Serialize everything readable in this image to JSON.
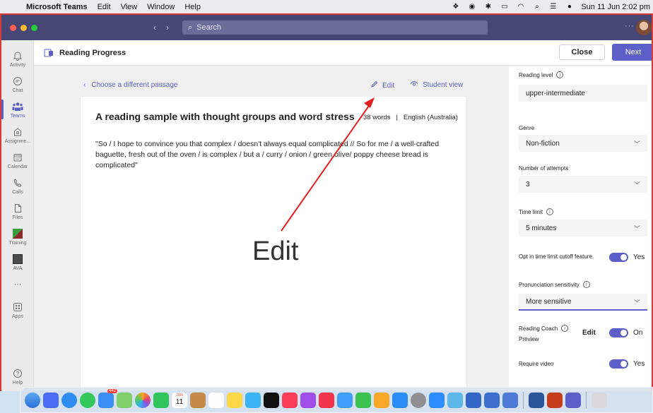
{
  "menubar": {
    "app_name": "Microsoft Teams",
    "menus": [
      "Edit",
      "View",
      "Window",
      "Help"
    ],
    "datetime": "Sun 11 Jun  2:02 pm"
  },
  "titlebar": {
    "search_placeholder": "Search",
    "more_label": "···"
  },
  "rail": {
    "items": [
      {
        "label": "Activity",
        "icon": "bell-icon"
      },
      {
        "label": "Chat",
        "icon": "chat-icon"
      },
      {
        "label": "Teams",
        "icon": "teams-icon"
      },
      {
        "label": "Assignme...",
        "icon": "assignments-icon"
      },
      {
        "label": "Calendar",
        "icon": "calendar-icon"
      },
      {
        "label": "Calls",
        "icon": "phone-icon"
      },
      {
        "label": "Files",
        "icon": "file-icon"
      },
      {
        "label": "Training",
        "icon": "training-icon"
      },
      {
        "label": "AVA",
        "icon": "ava-icon"
      },
      {
        "label": "···",
        "icon": "more-icon"
      },
      {
        "label": "Apps",
        "icon": "apps-icon"
      },
      {
        "label": "Help",
        "icon": "help-icon"
      }
    ]
  },
  "header": {
    "title": "Reading Progress",
    "close_label": "Close",
    "next_label": "Next"
  },
  "content": {
    "back_label": "Choose a different passage",
    "edit_label": "Edit",
    "student_view_label": "Student view",
    "passage_title": "A reading sample with thought groups and word stress",
    "word_count": "38 words",
    "separator": "|",
    "language": "English (Australia)",
    "passage_text": "\"So / I hope to convince you that complex / doesn't always equal complicated // So for me / a well-crafted baguette, fresh out of the oven / is complex / but a / curry / onion / green olive/ poppy cheese bread is complicated\""
  },
  "annotation": {
    "text": "Edit"
  },
  "settings": {
    "reading_level_label": "Reading level",
    "reading_level_value": "upper-intermediate",
    "genre_label": "Genre",
    "genre_value": "Non-fiction",
    "attempts_label": "Number of attempts",
    "attempts_value": "3",
    "time_limit_label": "Time limit",
    "time_limit_value": "5 minutes",
    "cutoff_label": "Opt in time limit cutoff feature.",
    "cutoff_value": "Yes",
    "pronunciation_label": "Pronunciation sensitivity",
    "pronunciation_value": "More sensitive",
    "reading_coach_label": "Reading Coach",
    "reading_coach_sub": "Preview",
    "reading_coach_edit": "Edit",
    "reading_coach_value": "On",
    "require_video_label": "Require video",
    "require_video_value": "Yes"
  },
  "dock": {
    "calendar_day": "11",
    "calendar_month": "JUN",
    "mail_badge": "442"
  },
  "colors": {
    "titlebar": "#464775",
    "accent": "#5b5fc7",
    "annotation_red": "#e02020"
  }
}
